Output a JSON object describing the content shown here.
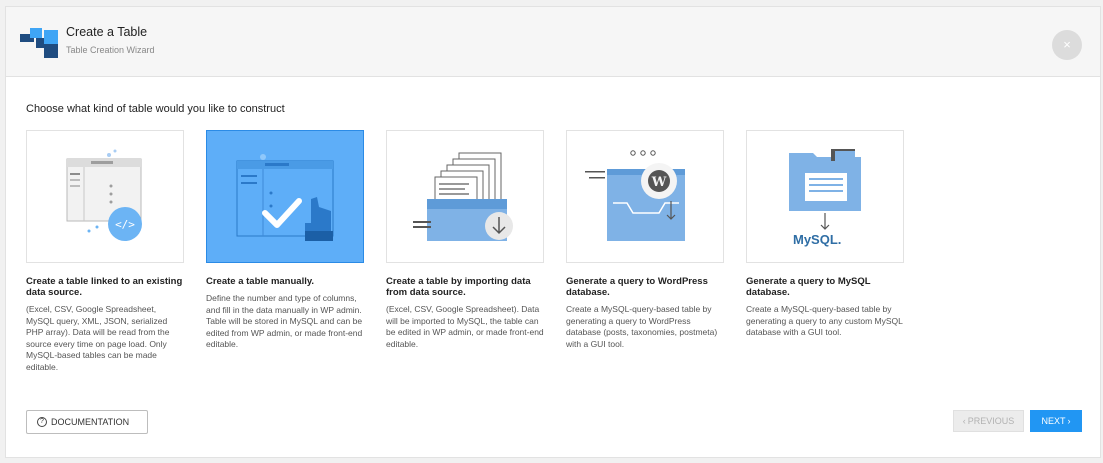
{
  "header": {
    "title": "Create a Table",
    "subtitle": "Table Creation Wizard",
    "close_icon": "×"
  },
  "prompt": "Choose what kind of table would you like to construct",
  "cards": [
    {
      "title": "Create a table linked to an existing data source.",
      "description": "(Excel, CSV, Google Spreadsheet, MySQL query, XML, JSON, serialized PHP array). Data will be read from the source every time on page load. Only MySQL-based tables can be made editable.",
      "icon": "code-browser-icon"
    },
    {
      "title": "Create a table manually.",
      "description": "Define the number and type of columns, and fill in the data manually in WP admin. Table will be stored in MySQL and can be edited from WP admin, or made front-end editable.",
      "icon": "manual-check-icon",
      "selected": true
    },
    {
      "title": "Create a table by importing data from data source.",
      "description": "(Excel, CSV, Google Spreadsheet). Data will be imported to MySQL, the table can be edited in WP admin, or made front-end editable.",
      "icon": "import-files-icon"
    },
    {
      "title": "Generate a query to WordPress database.",
      "description": "Create a MySQL-query-based table by generating a query to WordPress database (posts, taxonomies, postmeta) with a GUI tool.",
      "icon": "wordpress-query-icon"
    },
    {
      "title": "Generate a query to MySQL database.",
      "description": "Create a MySQL-query-based table by generating a query to any custom MySQL database with a GUI tool.",
      "icon": "mysql-query-icon",
      "logo_text": "MySQL."
    }
  ],
  "footer": {
    "documentation_label": "DOCUMENTATION",
    "previous_label": "PREVIOUS",
    "next_label": "NEXT"
  },
  "colors": {
    "accent": "#2196f3",
    "selected_card": "#5eaef8",
    "logo_dark": "#1f4c80",
    "logo_light": "#3fa5f5"
  }
}
